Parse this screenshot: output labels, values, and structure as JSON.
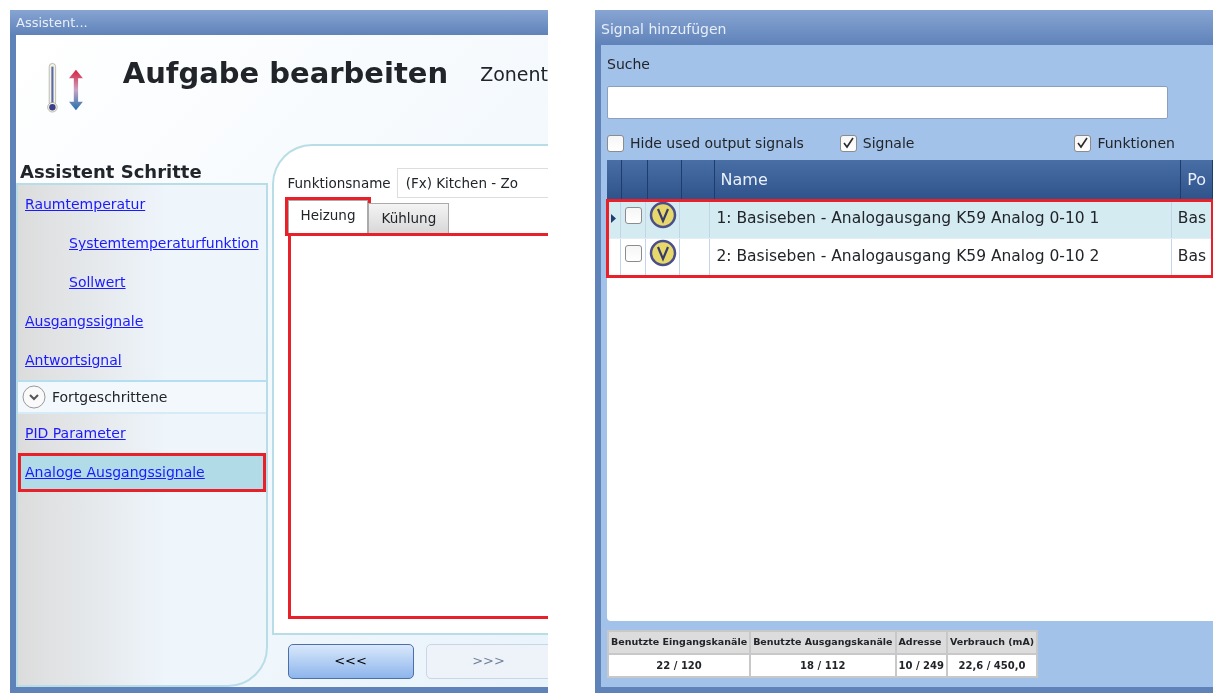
{
  "assistant_window": {
    "title": "Assistent...",
    "heading": "Aufgabe bearbeiten",
    "subheading": "Zonent",
    "steps_title": "Assistent Schritte",
    "steps": [
      {
        "label": "Raumtemperatur",
        "selected": false,
        "highlighted": false,
        "children": [
          {
            "label": "Systemtemperaturfunktion",
            "selected": false,
            "highlighted": false
          },
          {
            "label": "Sollwert",
            "selected": false,
            "highlighted": false
          }
        ]
      },
      {
        "label": "Ausgangssignale",
        "selected": false,
        "highlighted": false
      },
      {
        "label": "Antwortsignal",
        "selected": false,
        "highlighted": false
      }
    ],
    "advanced": {
      "label": "Fortgeschrittene",
      "expanded": true,
      "items": [
        {
          "label": "PID Parameter",
          "selected": false,
          "highlighted": false
        },
        {
          "label": "Analoge Ausgangssignale",
          "selected": true,
          "highlighted": true
        }
      ]
    },
    "function_label": "Funktionsname",
    "function_value": "(Fx) Kitchen - Zo",
    "tabs": [
      {
        "label": "Heizung",
        "selected": true,
        "highlighted": true
      },
      {
        "label": "Kühlung",
        "selected": false,
        "highlighted": false
      }
    ],
    "tab_panel_highlighted": true,
    "buttons": [
      {
        "label": "<<<",
        "disabled": false
      },
      {
        "label": ">>>",
        "disabled": true
      }
    ]
  },
  "signal_window": {
    "title": "Signal hinzufügen",
    "search": {
      "label": "Suche"
    },
    "filters": [
      {
        "label": "Hide used output signals",
        "checked": false
      },
      {
        "label": "Signale",
        "checked": true
      },
      {
        "label": "Funktionen",
        "checked": true
      }
    ],
    "table": {
      "columns": [
        "Name",
        "Po"
      ],
      "rows_highlighted": true,
      "rows": [
        {
          "name": "1: Basiseben - Analogausgang K59 Analog 0-10 1",
          "column_2": "Bas",
          "selected": true,
          "checked": false
        },
        {
          "name": "2: Basiseben - Analogausgang K59 Analog 0-10 2",
          "column_2": "Bas",
          "selected": false,
          "checked": false
        }
      ]
    },
    "stats": [
      {
        "label": "Benutzte Eingangskanäle",
        "value": "22 / 120"
      },
      {
        "label": "Benutzte Ausgangskanäle",
        "value": "18 / 112"
      },
      {
        "label": "Adresse",
        "value": "10 / 249"
      },
      {
        "label": "Verbrauch (mA)",
        "value": "22,6 / 450,0"
      }
    ]
  }
}
